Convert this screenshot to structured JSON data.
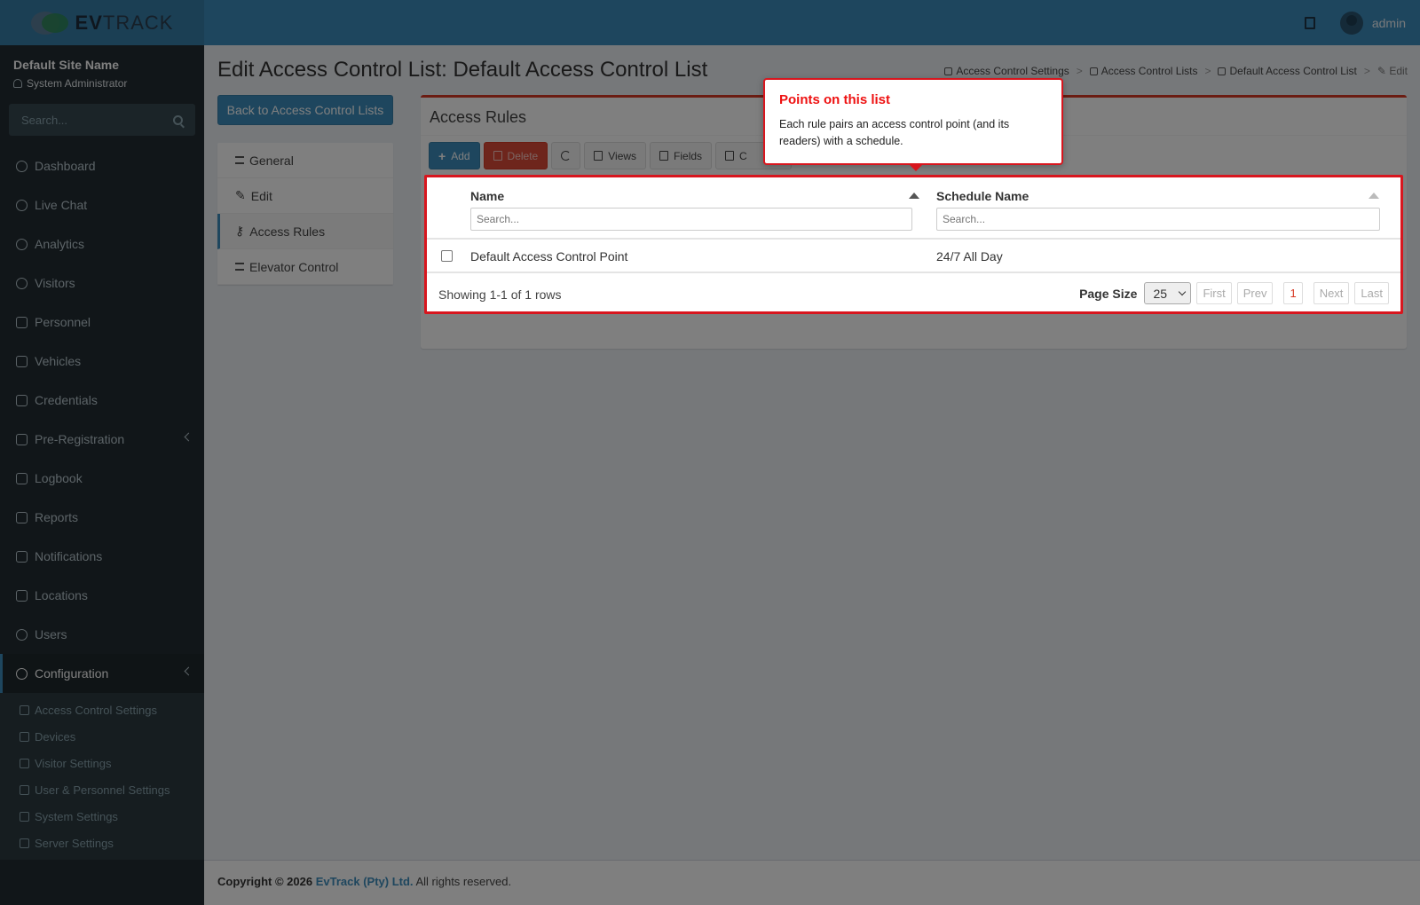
{
  "app": {
    "logo_ev": "EV",
    "logo_track": "TRACK"
  },
  "topbar": {
    "user_name": "admin"
  },
  "sidebar": {
    "site_name": "Default Site Name",
    "role": "System Administrator",
    "search_placeholder": "Search...",
    "items": [
      {
        "label": "Dashboard"
      },
      {
        "label": "Live Chat"
      },
      {
        "label": "Analytics"
      },
      {
        "label": "Visitors"
      },
      {
        "label": "Personnel"
      },
      {
        "label": "Vehicles"
      },
      {
        "label": "Credentials"
      },
      {
        "label": "Pre-Registration"
      },
      {
        "label": "Logbook"
      },
      {
        "label": "Reports"
      },
      {
        "label": "Notifications"
      },
      {
        "label": "Locations"
      },
      {
        "label": "Users"
      },
      {
        "label": "Configuration"
      }
    ],
    "sub_items": [
      {
        "label": "Access Control Settings"
      },
      {
        "label": "Devices"
      },
      {
        "label": "Visitor Settings"
      },
      {
        "label": "User & Personnel Settings"
      },
      {
        "label": "System Settings"
      },
      {
        "label": "Server Settings"
      }
    ]
  },
  "page": {
    "title": "Edit Access Control List: Default Access Control List",
    "breadcrumb": [
      "Access Control Settings",
      "Access Control Lists",
      "Default Access Control List",
      "Edit"
    ],
    "back_label": "Back to Access Control Lists",
    "tabs": [
      {
        "label": "General"
      },
      {
        "label": "Edit"
      },
      {
        "label": "Access Rules"
      },
      {
        "label": "Elevator Control"
      }
    ]
  },
  "box": {
    "title": "Access Rules",
    "toolbar": {
      "add": "Add",
      "delete": "Delete",
      "views": "Views",
      "fields": "Fields",
      "columns": "C"
    },
    "table": {
      "columns": [
        "Name",
        "Schedule Name"
      ],
      "search_placeholder": "Search...",
      "rows": [
        {
          "name": "Default Access Control Point",
          "schedule": "24/7 All Day"
        }
      ],
      "showing": "Showing 1-1 of 1 rows",
      "page_size_label": "Page Size",
      "page_size": "25",
      "pager": {
        "first": "First",
        "prev": "Prev",
        "current": "1",
        "next": "Next",
        "last": "Last"
      }
    }
  },
  "tooltip": {
    "title": "Points on this list",
    "body": "Each rule pairs an access control point (and its readers) with a schedule."
  },
  "footer": {
    "copyright": "Copyright © 2026",
    "brand": "EvTrack (Pty) Ltd.",
    "rights": "All rights reserved."
  }
}
